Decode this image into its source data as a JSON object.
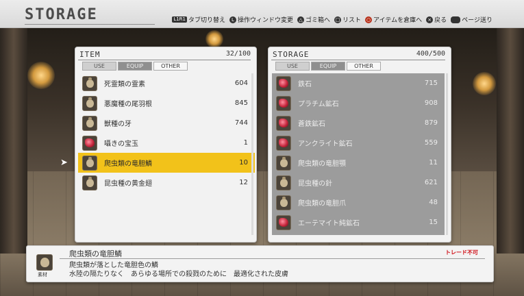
{
  "header": {
    "title": "STORAGE",
    "hints": [
      {
        "icon": "L1R1",
        "label": "タブ切り替え"
      },
      {
        "icon": "L",
        "label": "操作ウィンドウ変更"
      },
      {
        "icon": "△",
        "label": "ゴミ箱へ"
      },
      {
        "icon": "□",
        "label": "リスト"
      },
      {
        "icon": "○",
        "label": "アイテムを倉庫へ"
      },
      {
        "icon": "×",
        "label": "戻る"
      },
      {
        "icon": "pad",
        "label": "ページ送り"
      }
    ]
  },
  "item_panel": {
    "title": "ITEM",
    "count": "32/100",
    "tabs": [
      "USE",
      "EQUIP",
      "OTHER"
    ],
    "items": [
      {
        "name": "死霊類の霊素",
        "qty": "604",
        "icon": "pouch-icon"
      },
      {
        "name": "悪魔種の尾羽根",
        "qty": "845",
        "icon": "pouch-icon"
      },
      {
        "name": "獣種の牙",
        "qty": "744",
        "icon": "pouch-icon"
      },
      {
        "name": "囁きの宝玉",
        "qty": "1",
        "icon": "ore-icon"
      },
      {
        "name": "爬虫類の竜胆鱗",
        "qty": "10",
        "icon": "pouch-icon",
        "selected": true
      },
      {
        "name": "昆虫種の黄金翅",
        "qty": "12",
        "icon": "pouch-icon"
      }
    ]
  },
  "storage_panel": {
    "title": "STORAGE",
    "count": "400/500",
    "tabs": [
      "USE",
      "EQUIP",
      "OTHER"
    ],
    "items": [
      {
        "name": "鉄石",
        "qty": "715",
        "icon": "ore-icon"
      },
      {
        "name": "プラチム鉱石",
        "qty": "908",
        "icon": "ore-icon"
      },
      {
        "name": "蒼鉄鉱石",
        "qty": "879",
        "icon": "ore-icon"
      },
      {
        "name": "アンクライト鉱石",
        "qty": "559",
        "icon": "ore-icon"
      },
      {
        "name": "爬虫類の竜胆顎",
        "qty": "11",
        "icon": "pouch-icon"
      },
      {
        "name": "昆虫種の針",
        "qty": "621",
        "icon": "pouch-icon"
      },
      {
        "name": "爬虫類の竜胆爪",
        "qty": "48",
        "icon": "pouch-icon"
      },
      {
        "name": "エーテマイト純鉱石",
        "qty": "15",
        "icon": "ore-icon"
      }
    ]
  },
  "description": {
    "title": "爬虫類の竜胆鱗",
    "category": "素材",
    "trade": "トレード不可",
    "lines": [
      "爬虫類が落とした竜胆色の鱗",
      "水陸の隔たりなく　あらゆる場所での殺戮のために　最適化された皮膚"
    ]
  },
  "colors": {
    "selection": "#f2c21a",
    "trade_warning": "#d0131b"
  }
}
